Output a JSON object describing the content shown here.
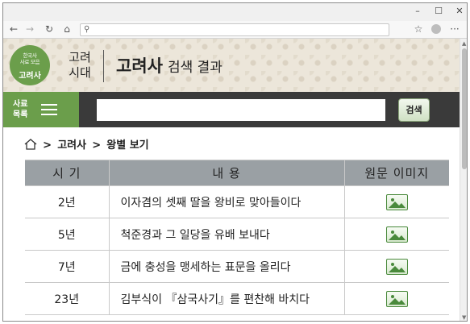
{
  "browser": {
    "window_controls": {
      "minimize": "–",
      "maximize": "☐",
      "close": "✕"
    },
    "nav_icons": [
      "back-arrow-icon",
      "forward-arrow-icon",
      "reload-icon",
      "home-icon"
    ],
    "address_bar": {
      "value": "",
      "icon": "search-icon"
    },
    "right_icons": [
      "favorites-icon",
      "profile-icon",
      "more-icon"
    ],
    "more_glyph": "···"
  },
  "header": {
    "logo": {
      "small_line1": "한국사",
      "small_line2": "사료 모음",
      "big": "고려사"
    },
    "era_label_line1": "고려",
    "era_label_line2": "시대",
    "title_main": "고려사",
    "title_sub": "검색 결과"
  },
  "search_bar": {
    "menu_label_line1": "사료",
    "menu_label_line2": "목록",
    "search_value": "",
    "search_button": "검색"
  },
  "breadcrumb": {
    "items": [
      "고려사",
      "왕별 보기"
    ],
    "separator": ">"
  },
  "table": {
    "headers": {
      "period": "시 기",
      "content": "내 용",
      "image": "원문 이미지"
    },
    "rows": [
      {
        "period": "2년",
        "content": "이자겸의 셋째 딸을 왕비로 맞아들이다"
      },
      {
        "period": "5년",
        "content": "척준경과 그 일당을 유배 보내다"
      },
      {
        "period": "7년",
        "content": "금에 충성을 맹세하는 표문을 올리다"
      },
      {
        "period": "23년",
        "content": "김부식이 『삼국사기』를 편찬해 바치다"
      }
    ]
  },
  "colors": {
    "accent_green": "#6b9e4b",
    "search_bar_bg": "#3a3a3a",
    "table_header_bg": "#9aa0a4"
  }
}
